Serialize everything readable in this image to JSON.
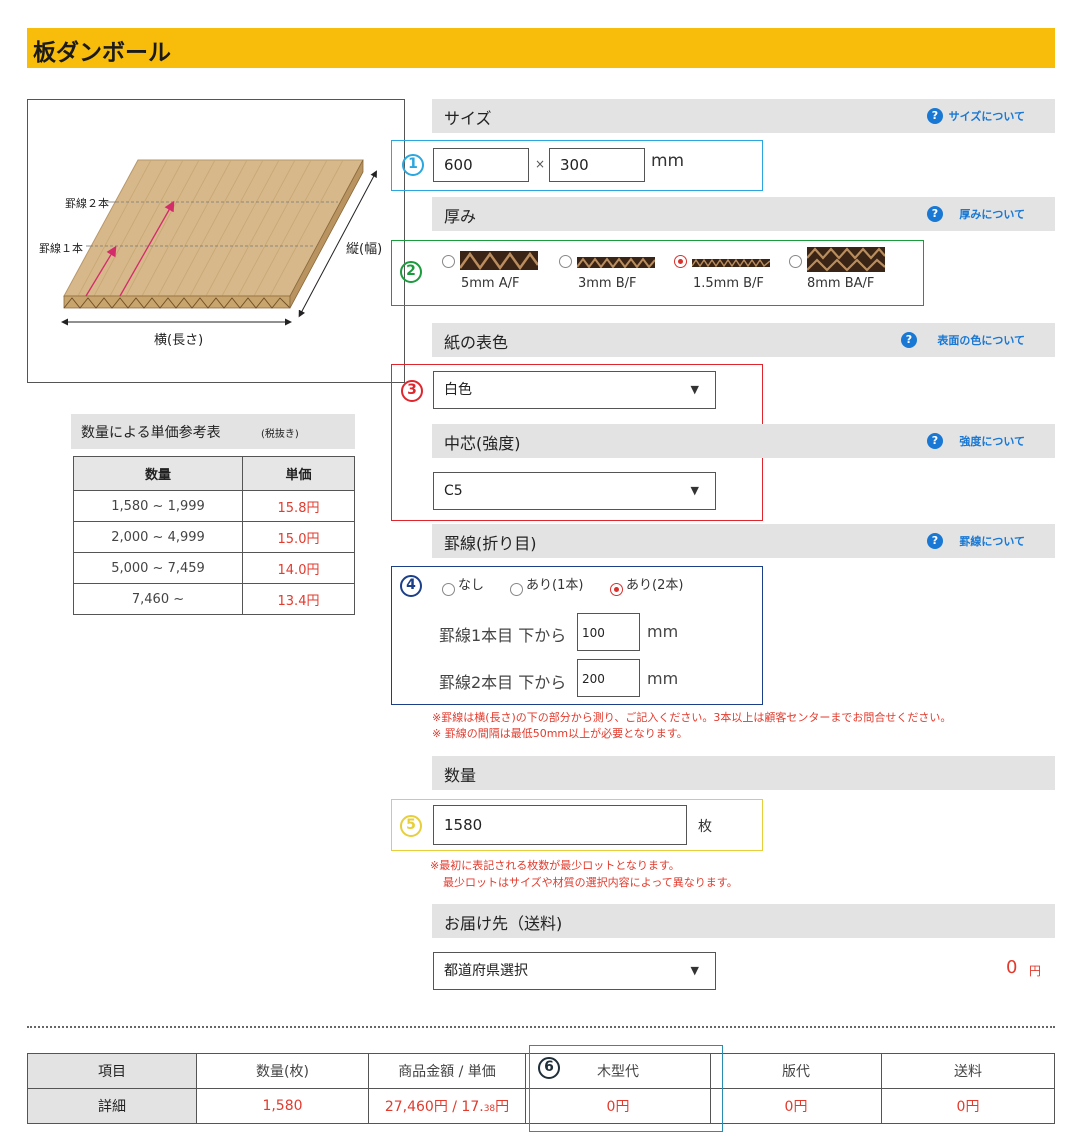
{
  "title": "板ダンボール",
  "illustration": {
    "label_score2": "罫線２本",
    "label_score1": "罫線１本",
    "label_width": "縦(幅)",
    "label_length": "横(長さ)"
  },
  "price_table": {
    "heading": "数量による単価参考表",
    "tax_note": "(税抜き)",
    "col_qty": "数量",
    "col_unit": "単価",
    "rows": [
      {
        "qty": "1,580 ~ 1,999",
        "price": "15.8円"
      },
      {
        "qty": "2,000 ~ 4,999",
        "price": "15.0円"
      },
      {
        "qty": "5,000 ~ 7,459",
        "price": "14.0円"
      },
      {
        "qty": "7,460 ~",
        "price": "13.4円"
      }
    ]
  },
  "size": {
    "label": "サイズ",
    "help": "サイズについて",
    "badge": "1",
    "width": "600",
    "times": "×",
    "height": "300",
    "unit": "mm"
  },
  "thickness": {
    "label": "厚み",
    "help": "厚みについて",
    "badge": "2",
    "options": [
      {
        "label": "5mm A/F",
        "selected": false
      },
      {
        "label": "3mm B/F",
        "selected": false
      },
      {
        "label": "1.5mm B/F",
        "selected": true
      },
      {
        "label": "8mm BA/F",
        "selected": false
      }
    ]
  },
  "color": {
    "label": "紙の表色",
    "help": "表面の色について",
    "badge": "3",
    "value": "白色"
  },
  "core": {
    "label": "中芯(強度)",
    "help": "強度について",
    "value": "C5"
  },
  "score": {
    "label": "罫線(折り目)",
    "help": "罫線について",
    "badge": "4",
    "opt_none": "なし",
    "opt_one": "あり(1本)",
    "opt_two": "あり(2本)",
    "line1_label": "罫線1本目 下から",
    "line1_value": "100",
    "line2_label": "罫線2本目 下から",
    "line2_value": "200",
    "unit": "mm",
    "note1": "※罫線は横(長さ)の下の部分から測り、ご記入ください。3本以上は顧客センターまでお問合せください。",
    "note2": "※ 罫線の間隔は最低50mm以上が必要となります。"
  },
  "quantity": {
    "label": "数量",
    "badge": "5",
    "value": "1580",
    "unit": "枚",
    "note1": "※最初に表記される枚数が最少ロットとなります。",
    "note2": "最少ロットはサイズや材質の選択内容によって異なります。"
  },
  "delivery": {
    "label": "お届け先（送料)",
    "value": "都道府県選択",
    "price": "0",
    "yen": "円"
  },
  "summary": {
    "badge": "6",
    "headers": [
      "項目",
      "数量(枚)",
      "商品金額 / 単価",
      "木型代",
      "版代",
      "送料"
    ],
    "row_label": "詳細",
    "qty": "1,580",
    "amount": "27,460円 / 17.",
    "amount_small": "38",
    "amount_yen": "円",
    "die": "0円",
    "plate": "0円",
    "shipping": "0円"
  },
  "colors": {
    "title_bg": "#f7bd0a",
    "frame1": "#2ba6de",
    "frame2": "#1a9b3c",
    "frame3": "#e0262c",
    "frame4": "#1c3f8a",
    "frame5": "#e6cf3a",
    "frame6": "#2a8cae",
    "accent_red": "#e23a2c",
    "link_blue": "#1878d4"
  }
}
